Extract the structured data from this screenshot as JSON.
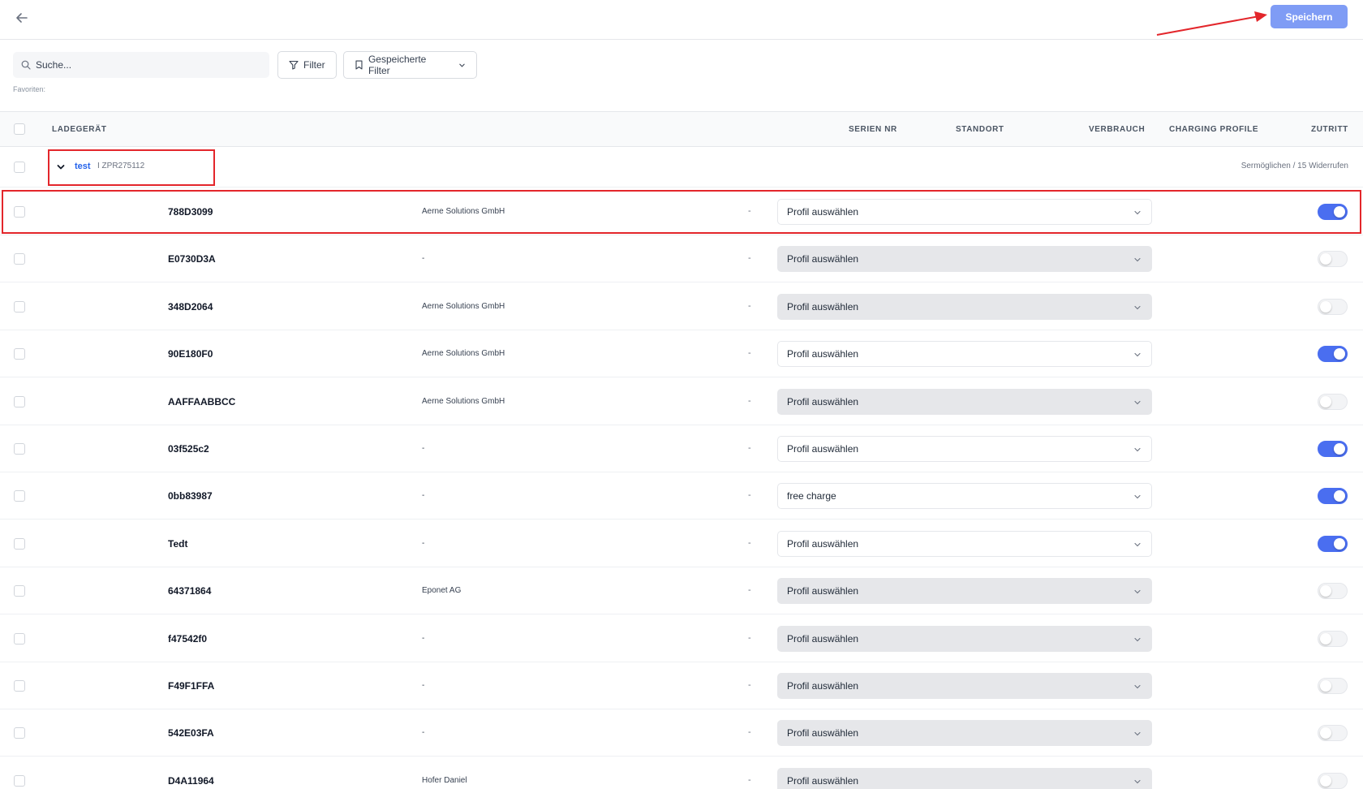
{
  "toolbar": {
    "save_label": "Speichern"
  },
  "search": {
    "placeholder": "Suche..."
  },
  "filters": {
    "filter_label": "Filter",
    "saved_label": "Gespeicherte Filter",
    "favorites_label": "Favoriten:"
  },
  "columns": {
    "charger": "LADEGERÄT",
    "serial": "SERIEN NR",
    "location": "STANDORT",
    "usage": "VERBRAUCH",
    "profile": "CHARGING PROFILE",
    "access": "ZUTRITT"
  },
  "group": {
    "name": "test",
    "id": "I ZPR275112",
    "actions": "Sermöglichen / 15 Widerrufen"
  },
  "rows": [
    {
      "name": "788D3099",
      "location": "Aerne Solutions GmbH",
      "usage": "-",
      "profile": "Profil auswählen",
      "profile_enabled": true,
      "access": true
    },
    {
      "name": "E0730D3A",
      "location": "-",
      "usage": "-",
      "profile": "Profil auswählen",
      "profile_enabled": false,
      "access": false
    },
    {
      "name": "348D2064",
      "location": "Aerne Solutions GmbH",
      "usage": "-",
      "profile": "Profil auswählen",
      "profile_enabled": false,
      "access": false
    },
    {
      "name": "90E180F0",
      "location": "Aerne Solutions GmbH",
      "usage": "-",
      "profile": "Profil auswählen",
      "profile_enabled": true,
      "access": true
    },
    {
      "name": "AAFFAABBCC",
      "location": "Aerne Solutions GmbH",
      "usage": "-",
      "profile": "Profil auswählen",
      "profile_enabled": false,
      "access": false
    },
    {
      "name": "03f525c2",
      "location": "-",
      "usage": "-",
      "profile": "Profil auswählen",
      "profile_enabled": true,
      "access": true
    },
    {
      "name": "0bb83987",
      "location": "-",
      "usage": "-",
      "profile": "free charge",
      "profile_enabled": true,
      "access": true
    },
    {
      "name": "Tedt",
      "location": "-",
      "usage": "-",
      "profile": "Profil auswählen",
      "profile_enabled": true,
      "access": true
    },
    {
      "name": "64371864",
      "location": "Eponet AG",
      "usage": "-",
      "profile": "Profil auswählen",
      "profile_enabled": false,
      "access": false
    },
    {
      "name": "f47542f0",
      "location": "-",
      "usage": "-",
      "profile": "Profil auswählen",
      "profile_enabled": false,
      "access": false
    },
    {
      "name": "F49F1FFA",
      "location": "-",
      "usage": "-",
      "profile": "Profil auswählen",
      "profile_enabled": false,
      "access": false
    },
    {
      "name": "542E03FA",
      "location": "-",
      "usage": "-",
      "profile": "Profil auswählen",
      "profile_enabled": false,
      "access": false
    },
    {
      "name": "D4A11964",
      "location": "Hofer Daniel",
      "usage": "-",
      "profile": "Profil auswählen",
      "profile_enabled": false,
      "access": false
    }
  ],
  "colors": {
    "accent": "#4a6ef0",
    "save_button": "#7f9cf5",
    "annotation": "#e3262b",
    "link": "#2563eb"
  }
}
